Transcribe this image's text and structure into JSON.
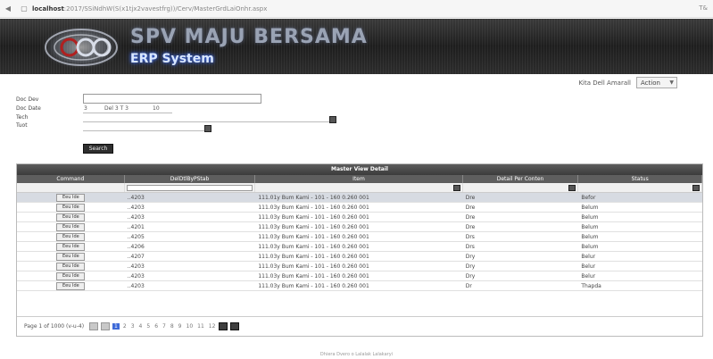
{
  "browser": {
    "url_host": "localhost",
    "url_path": ":2017/SSiNdhW(S(x1tjx2vavestfrg))/Cerv/MasterGrdLaiOnhr.aspx",
    "right_badge": "T&"
  },
  "banner": {
    "title": "SPV MAJU BERSAMA",
    "subtitle": "ERP System"
  },
  "user": {
    "name": "Kita Dell Amarall",
    "action_select": "Action"
  },
  "filter": {
    "label_name": "Doc Dev",
    "label_period": "Doc Date",
    "label_from": "Tech",
    "label_to": "Tuot",
    "period_text_1": "3",
    "period_text_2": "Del 3 T 3",
    "period_text_3": "10",
    "search_label": "Search"
  },
  "grid": {
    "caption": "Master View Detail",
    "columns": [
      "Command",
      "DelDtlByPStab",
      "Item",
      "Detail Per Conten",
      "Status"
    ],
    "rows": [
      {
        "command": "Eeu Ide",
        "code": "..4203",
        "item": "111.01y Bum Kami - 101 - 160 0.260 001",
        "detail": "Dre",
        "status": "Befor"
      },
      {
        "command": "Eeu Ide",
        "code": "..4203",
        "item": "111.03y Bum Kami - 101 - 160 0.260 001",
        "detail": "Dre",
        "status": "Belum"
      },
      {
        "command": "Eeu Ide",
        "code": "..4203",
        "item": "111.03y Bum Kami - 101 - 160 0.260 001",
        "detail": "Dre",
        "status": "Belum"
      },
      {
        "command": "Eeu Ide",
        "code": "..4201",
        "item": "111.03y Bum Kami - 101 - 160 0.260 001",
        "detail": "Dre",
        "status": "Belum"
      },
      {
        "command": "Eeu Ide",
        "code": "..4205",
        "item": "111.03y Bum Kami - 101 - 160 0.260 001",
        "detail": "Drs",
        "status": "Belum"
      },
      {
        "command": "Eeu Ide",
        "code": "..4206",
        "item": "111.03y Bum Kami - 101 - 160 0.260 001",
        "detail": "Drs",
        "status": "Belum"
      },
      {
        "command": "Eeu Ide",
        "code": "..4207",
        "item": "111.03y Bum Kami - 101 - 160 0.260 001",
        "detail": "Dry",
        "status": "Belur"
      },
      {
        "command": "Eeu Ide",
        "code": "..4203",
        "item": "111.03y Bum Kami - 101 - 160 0.260 001",
        "detail": "Dry",
        "status": "Belur"
      },
      {
        "command": "Eeu Ide",
        "code": "..4203",
        "item": "111.03y Bum Kami - 101 - 160 0.260 001",
        "detail": "Dry",
        "status": "Belur"
      },
      {
        "command": "Eeu Ide",
        "code": "..4203",
        "item": "111.03y Bum Kami - 101 - 160 0.260 001",
        "detail": "Dr",
        "status": "Thapda"
      }
    ],
    "pager_info": "Page 1 of 1000 (v-u-4)",
    "pages": [
      "1",
      "2",
      "3",
      "4",
      "5",
      "6",
      "7",
      "8",
      "9",
      "10",
      "11",
      "12"
    ],
    "current_page": "1"
  },
  "footer": {
    "text": "Dhiera Dvero o Lalalak Lalakaryi"
  }
}
